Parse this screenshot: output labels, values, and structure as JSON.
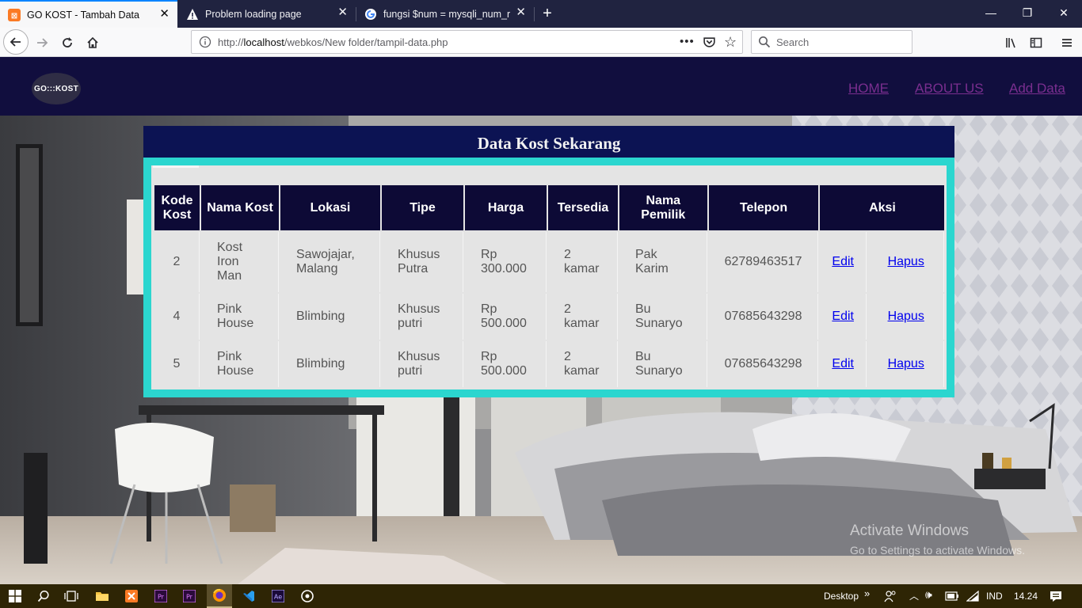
{
  "browser": {
    "tabs": [
      {
        "title": "GO KOST - Tambah Data",
        "active": true
      },
      {
        "title": "Problem loading page",
        "active": false
      },
      {
        "title": "fungsi $num = mysqli_num_ro",
        "active": false
      }
    ],
    "url_prefix": "http://",
    "url_host": "localhost",
    "url_path": "/webkos/New folder/tampil-data.php",
    "search_placeholder": "Search"
  },
  "site": {
    "logo_text": "GO:::KOST",
    "menu": [
      {
        "label": "HOME"
      },
      {
        "label": "ABOUT US"
      },
      {
        "label": "Add Data"
      }
    ]
  },
  "table": {
    "title": "Data Kost Sekarang",
    "headers": [
      "Kode Kost",
      "Nama Kost",
      "Lokasi",
      "Tipe",
      "Harga",
      "Tersedia",
      "Nama Pemilik",
      "Telepon",
      "Aksi"
    ],
    "rows": [
      {
        "kode": "2",
        "nama": "Kost Iron Man",
        "lokasi": "Sawojajar, Malang",
        "tipe": "Khusus Putra",
        "harga": "Rp 300.000",
        "tersedia": "2 kamar",
        "pemilik": "Pak Karim",
        "telepon": "62789463517",
        "edit": "Edit",
        "hapus": "Hapus"
      },
      {
        "kode": "4",
        "nama": "Pink House",
        "lokasi": "Blimbing",
        "tipe": "Khusus putri",
        "harga": "Rp 500.000",
        "tersedia": "2 kamar",
        "pemilik": "Bu Sunaryo",
        "telepon": "07685643298",
        "edit": "Edit",
        "hapus": "Hapus"
      },
      {
        "kode": "5",
        "nama": "Pink House",
        "lokasi": "Blimbing",
        "tipe": "Khusus putri",
        "harga": "Rp 500.000",
        "tersedia": "2 kamar",
        "pemilik": "Bu Sunaryo",
        "telepon": "07685643298",
        "edit": "Edit",
        "hapus": "Hapus"
      }
    ]
  },
  "watermark": {
    "line1": "Activate Windows",
    "line2": "Go to Settings to activate Windows."
  },
  "taskbar": {
    "desktop_label": "Desktop",
    "language": "IND",
    "time": "14.24"
  },
  "colors": {
    "site_header": "#110e3e",
    "table_title_bg": "#0c1353",
    "frame": "#2bd6cf",
    "th_bg": "#0d0a36",
    "menu_link": "#7a2e8f"
  }
}
